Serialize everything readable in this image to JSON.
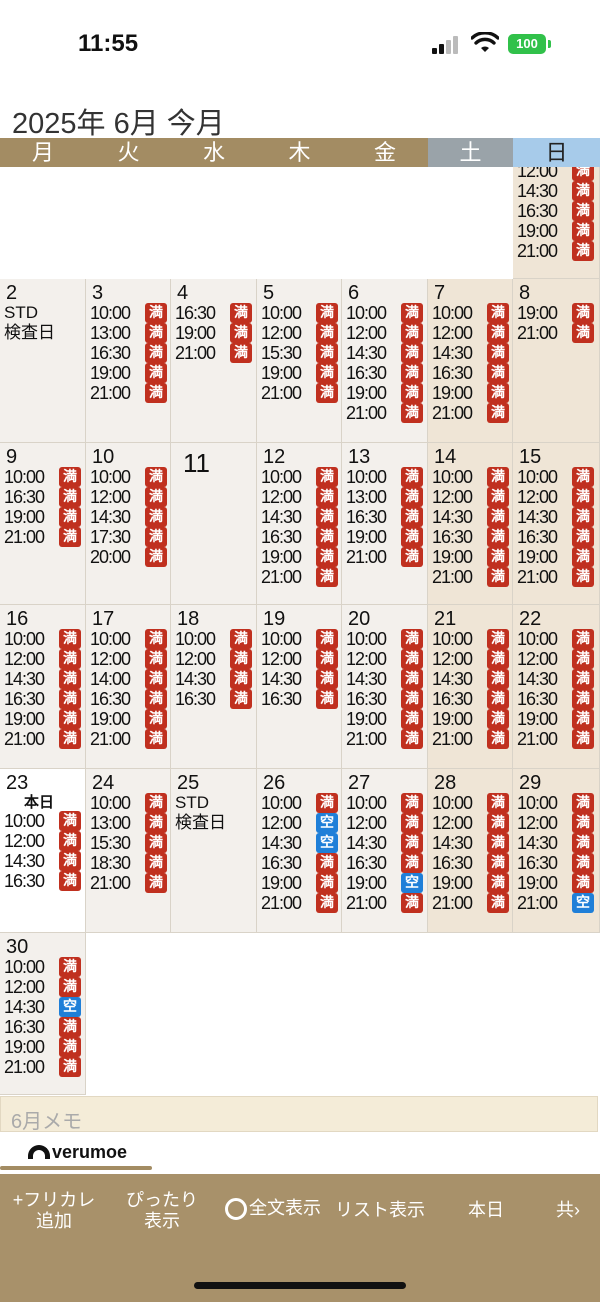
{
  "status": {
    "time": "11:55",
    "battery": "100"
  },
  "header": {
    "title": "2025年 6月 今月"
  },
  "weekdays": [
    "月",
    "火",
    "水",
    "木",
    "金",
    "土",
    "日"
  ],
  "colors": {
    "full": "#c0301f",
    "open": "#1f7fd8",
    "header_brown": "#a38c63",
    "sat": "#9aa3a9",
    "sun": "#a7cbea"
  },
  "badges": {
    "full": "満",
    "open": "空"
  },
  "weeks": [
    [
      null,
      null,
      null,
      null,
      null,
      null,
      {
        "day": "",
        "slots": [
          [
            "12:00",
            "満"
          ],
          [
            "14:30",
            "満"
          ],
          [
            "16:30",
            "満"
          ],
          [
            "19:00",
            "満"
          ],
          [
            "21:00",
            "満"
          ]
        ]
      }
    ],
    [
      {
        "day": "2",
        "notes": [
          "STD",
          "検査日"
        ],
        "slots": []
      },
      {
        "day": "3",
        "slots": [
          [
            "10:00",
            "満"
          ],
          [
            "13:00",
            "満"
          ],
          [
            "16:30",
            "満"
          ],
          [
            "19:00",
            "満"
          ],
          [
            "21:00",
            "満"
          ]
        ]
      },
      {
        "day": "4",
        "slots": [
          [
            "16:30",
            "満"
          ],
          [
            "19:00",
            "満"
          ],
          [
            "21:00",
            "満"
          ]
        ]
      },
      {
        "day": "5",
        "slots": [
          [
            "10:00",
            "満"
          ],
          [
            "12:00",
            "満"
          ],
          [
            "15:30",
            "満"
          ],
          [
            "19:00",
            "満"
          ],
          [
            "21:00",
            "満"
          ]
        ]
      },
      {
        "day": "6",
        "slots": [
          [
            "10:00",
            "満"
          ],
          [
            "12:00",
            "満"
          ],
          [
            "14:30",
            "満"
          ],
          [
            "16:30",
            "満"
          ],
          [
            "19:00",
            "満"
          ],
          [
            "21:00",
            "満"
          ]
        ]
      },
      {
        "day": "7",
        "slots": [
          [
            "10:00",
            "満"
          ],
          [
            "12:00",
            "満"
          ],
          [
            "14:30",
            "満"
          ],
          [
            "16:30",
            "満"
          ],
          [
            "19:00",
            "満"
          ],
          [
            "21:00",
            "満"
          ]
        ]
      },
      {
        "day": "8",
        "slots": [
          [
            "19:00",
            "満"
          ],
          [
            "21:00",
            "満"
          ]
        ]
      }
    ],
    [
      {
        "day": "9",
        "slots": [
          [
            "10:00",
            "満"
          ],
          [
            "16:30",
            "満"
          ],
          [
            "19:00",
            "満"
          ],
          [
            "21:00",
            "満"
          ]
        ]
      },
      {
        "day": "10",
        "slots": [
          [
            "10:00",
            "満"
          ],
          [
            "12:00",
            "満"
          ],
          [
            "14:30",
            "満"
          ],
          [
            "17:30",
            "満"
          ],
          [
            "20:00",
            "満"
          ]
        ]
      },
      {
        "day": "11",
        "big": true,
        "slots": []
      },
      {
        "day": "12",
        "slots": [
          [
            "10:00",
            "満"
          ],
          [
            "12:00",
            "満"
          ],
          [
            "14:30",
            "満"
          ],
          [
            "16:30",
            "満"
          ],
          [
            "19:00",
            "満"
          ],
          [
            "21:00",
            "満"
          ]
        ]
      },
      {
        "day": "13",
        "slots": [
          [
            "10:00",
            "満"
          ],
          [
            "13:00",
            "満"
          ],
          [
            "16:30",
            "満"
          ],
          [
            "19:00",
            "満"
          ],
          [
            "21:00",
            "満"
          ]
        ]
      },
      {
        "day": "14",
        "slots": [
          [
            "10:00",
            "満"
          ],
          [
            "12:00",
            "満"
          ],
          [
            "14:30",
            "満"
          ],
          [
            "16:30",
            "満"
          ],
          [
            "19:00",
            "満"
          ],
          [
            "21:00",
            "満"
          ]
        ]
      },
      {
        "day": "15",
        "slots": [
          [
            "10:00",
            "満"
          ],
          [
            "12:00",
            "満"
          ],
          [
            "14:30",
            "満"
          ],
          [
            "16:30",
            "満"
          ],
          [
            "19:00",
            "満"
          ],
          [
            "21:00",
            "満"
          ]
        ]
      }
    ],
    [
      {
        "day": "16",
        "slots": [
          [
            "10:00",
            "満"
          ],
          [
            "12:00",
            "満"
          ],
          [
            "14:30",
            "満"
          ],
          [
            "16:30",
            "満"
          ],
          [
            "19:00",
            "満"
          ],
          [
            "21:00",
            "満"
          ]
        ]
      },
      {
        "day": "17",
        "slots": [
          [
            "10:00",
            "満"
          ],
          [
            "12:00",
            "満"
          ],
          [
            "14:00",
            "満"
          ],
          [
            "16:30",
            "満"
          ],
          [
            "19:00",
            "満"
          ],
          [
            "21:00",
            "満"
          ]
        ]
      },
      {
        "day": "18",
        "slots": [
          [
            "10:00",
            "満"
          ],
          [
            "12:00",
            "満"
          ],
          [
            "14:30",
            "満"
          ],
          [
            "16:30",
            "満"
          ]
        ]
      },
      {
        "day": "19",
        "slots": [
          [
            "10:00",
            "満"
          ],
          [
            "12:00",
            "満"
          ],
          [
            "14:30",
            "満"
          ],
          [
            "16:30",
            "満"
          ]
        ]
      },
      {
        "day": "20",
        "slots": [
          [
            "10:00",
            "満"
          ],
          [
            "12:00",
            "満"
          ],
          [
            "14:30",
            "満"
          ],
          [
            "16:30",
            "満"
          ],
          [
            "19:00",
            "満"
          ],
          [
            "21:00",
            "満"
          ]
        ]
      },
      {
        "day": "21",
        "slots": [
          [
            "10:00",
            "満"
          ],
          [
            "12:00",
            "満"
          ],
          [
            "14:30",
            "満"
          ],
          [
            "16:30",
            "満"
          ],
          [
            "19:00",
            "満"
          ],
          [
            "21:00",
            "満"
          ]
        ]
      },
      {
        "day": "22",
        "slots": [
          [
            "10:00",
            "満"
          ],
          [
            "12:00",
            "満"
          ],
          [
            "14:30",
            "満"
          ],
          [
            "16:30",
            "満"
          ],
          [
            "19:00",
            "満"
          ],
          [
            "21:00",
            "満"
          ]
        ]
      }
    ],
    [
      {
        "day": "23",
        "today": "本日",
        "slots": [
          [
            "10:00",
            "満"
          ],
          [
            "12:00",
            "満"
          ],
          [
            "14:30",
            "満"
          ],
          [
            "16:30",
            "満"
          ]
        ]
      },
      {
        "day": "24",
        "slots": [
          [
            "10:00",
            "満"
          ],
          [
            "13:00",
            "満"
          ],
          [
            "15:30",
            "満"
          ],
          [
            "18:30",
            "満"
          ],
          [
            "21:00",
            "満"
          ]
        ]
      },
      {
        "day": "25",
        "notes": [
          "STD",
          "検査日"
        ],
        "slots": []
      },
      {
        "day": "26",
        "slots": [
          [
            "10:00",
            "満"
          ],
          [
            "12:00",
            "空"
          ],
          [
            "14:30",
            "空"
          ],
          [
            "16:30",
            "満"
          ],
          [
            "19:00",
            "満"
          ],
          [
            "21:00",
            "満"
          ]
        ]
      },
      {
        "day": "27",
        "slots": [
          [
            "10:00",
            "満"
          ],
          [
            "12:00",
            "満"
          ],
          [
            "14:30",
            "満"
          ],
          [
            "16:30",
            "満"
          ],
          [
            "19:00",
            "空"
          ],
          [
            "21:00",
            "満"
          ]
        ]
      },
      {
        "day": "28",
        "slots": [
          [
            "10:00",
            "満"
          ],
          [
            "12:00",
            "満"
          ],
          [
            "14:30",
            "満"
          ],
          [
            "16:30",
            "満"
          ],
          [
            "19:00",
            "満"
          ],
          [
            "21:00",
            "満"
          ]
        ]
      },
      {
        "day": "29",
        "slots": [
          [
            "10:00",
            "満"
          ],
          [
            "12:00",
            "満"
          ],
          [
            "14:30",
            "満"
          ],
          [
            "16:30",
            "満"
          ],
          [
            "19:00",
            "満"
          ],
          [
            "21:00",
            "空"
          ]
        ]
      }
    ],
    [
      {
        "day": "30",
        "slots": [
          [
            "10:00",
            "満"
          ],
          [
            "12:00",
            "満"
          ],
          [
            "14:30",
            "空"
          ],
          [
            "16:30",
            "満"
          ],
          [
            "19:00",
            "満"
          ],
          [
            "21:00",
            "満"
          ]
        ]
      },
      null,
      null,
      null,
      null,
      null,
      null
    ]
  ],
  "memo": {
    "placeholder": "6月メモ"
  },
  "logo": {
    "text": "verumoe"
  },
  "toolbar": {
    "items": [
      {
        "label": "+フリカレ\n追加"
      },
      {
        "label": "ぴったり\n表示"
      },
      {
        "label": "全文表示"
      },
      {
        "label": "リスト表示"
      },
      {
        "label": "本日"
      },
      {
        "label": "共"
      }
    ]
  }
}
